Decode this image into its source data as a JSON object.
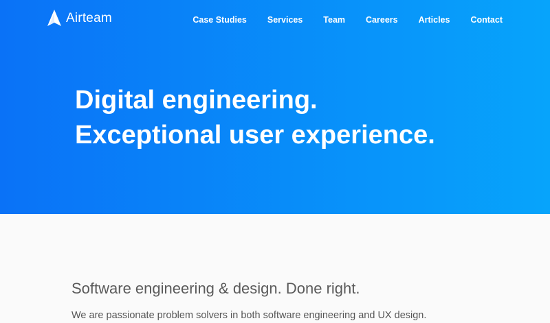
{
  "brand": {
    "name": "Airteam",
    "logo_icon": "airteam-logo-icon"
  },
  "nav": {
    "items": [
      {
        "label": "Case Studies"
      },
      {
        "label": "Services"
      },
      {
        "label": "Team"
      },
      {
        "label": "Careers"
      },
      {
        "label": "Articles"
      },
      {
        "label": "Contact"
      }
    ]
  },
  "hero": {
    "line1": "Digital engineering.",
    "line2": "Exceptional user experience.",
    "gradient_start": "#0a72f7",
    "gradient_end": "#07a4fb"
  },
  "intro": {
    "heading": "Software engineering & design. Done right.",
    "body": "We are passionate problem solvers in both software engineering and UX design."
  }
}
